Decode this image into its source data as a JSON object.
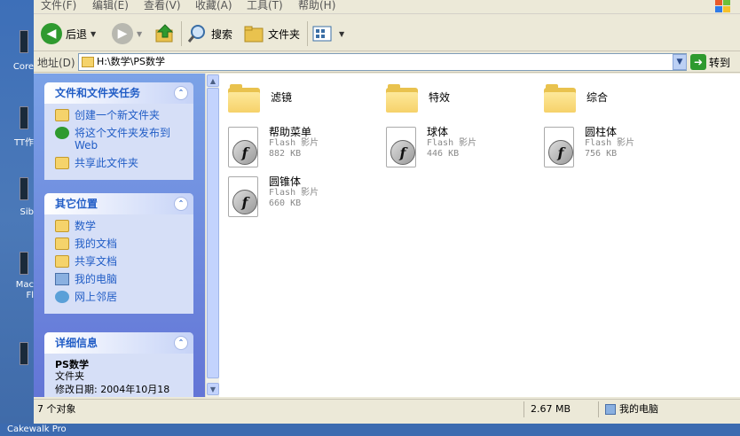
{
  "desktop": {
    "labels": [
      "Core",
      "TT作",
      "Sib",
      "Mac",
      "Fl"
    ],
    "bottom": "Cakewalk Pro"
  },
  "menu": [
    "文件(F)",
    "编辑(E)",
    "查看(V)",
    "收藏(A)",
    "工具(T)",
    "帮助(H)"
  ],
  "toolbar": {
    "back": "后退",
    "search": "搜索",
    "folders": "文件夹"
  },
  "address": {
    "label": "地址(D)",
    "value": "H:\\数学\\PS数学",
    "go": "转到"
  },
  "tasks": {
    "title": "文件和文件夹任务",
    "items": [
      "创建一个新文件夹",
      "将这个文件夹发布到 Web",
      "共享此文件夹"
    ]
  },
  "places": {
    "title": "其它位置",
    "items": [
      "数学",
      "我的文档",
      "共享文档",
      "我的电脑",
      "网上邻居"
    ]
  },
  "details": {
    "title": "详细信息",
    "name": "PS数学",
    "kind": "文件夹",
    "modified": "修改日期: 2004年10月18"
  },
  "files": [
    {
      "name": "滤镜",
      "type": "folder"
    },
    {
      "name": "特效",
      "type": "folder"
    },
    {
      "name": "综合",
      "type": "folder"
    },
    {
      "name": "帮助菜单",
      "type": "flash",
      "kind": "Flash 影片",
      "size": "882 KB"
    },
    {
      "name": "球体",
      "type": "flash",
      "kind": "Flash 影片",
      "size": "446 KB"
    },
    {
      "name": "圆柱体",
      "type": "flash",
      "kind": "Flash 影片",
      "size": "756 KB"
    },
    {
      "name": "圆锥体",
      "type": "flash",
      "kind": "Flash 影片",
      "size": "660 KB"
    }
  ],
  "status": {
    "count": "7 个对象",
    "size": "2.67 MB",
    "location": "我的电脑"
  }
}
